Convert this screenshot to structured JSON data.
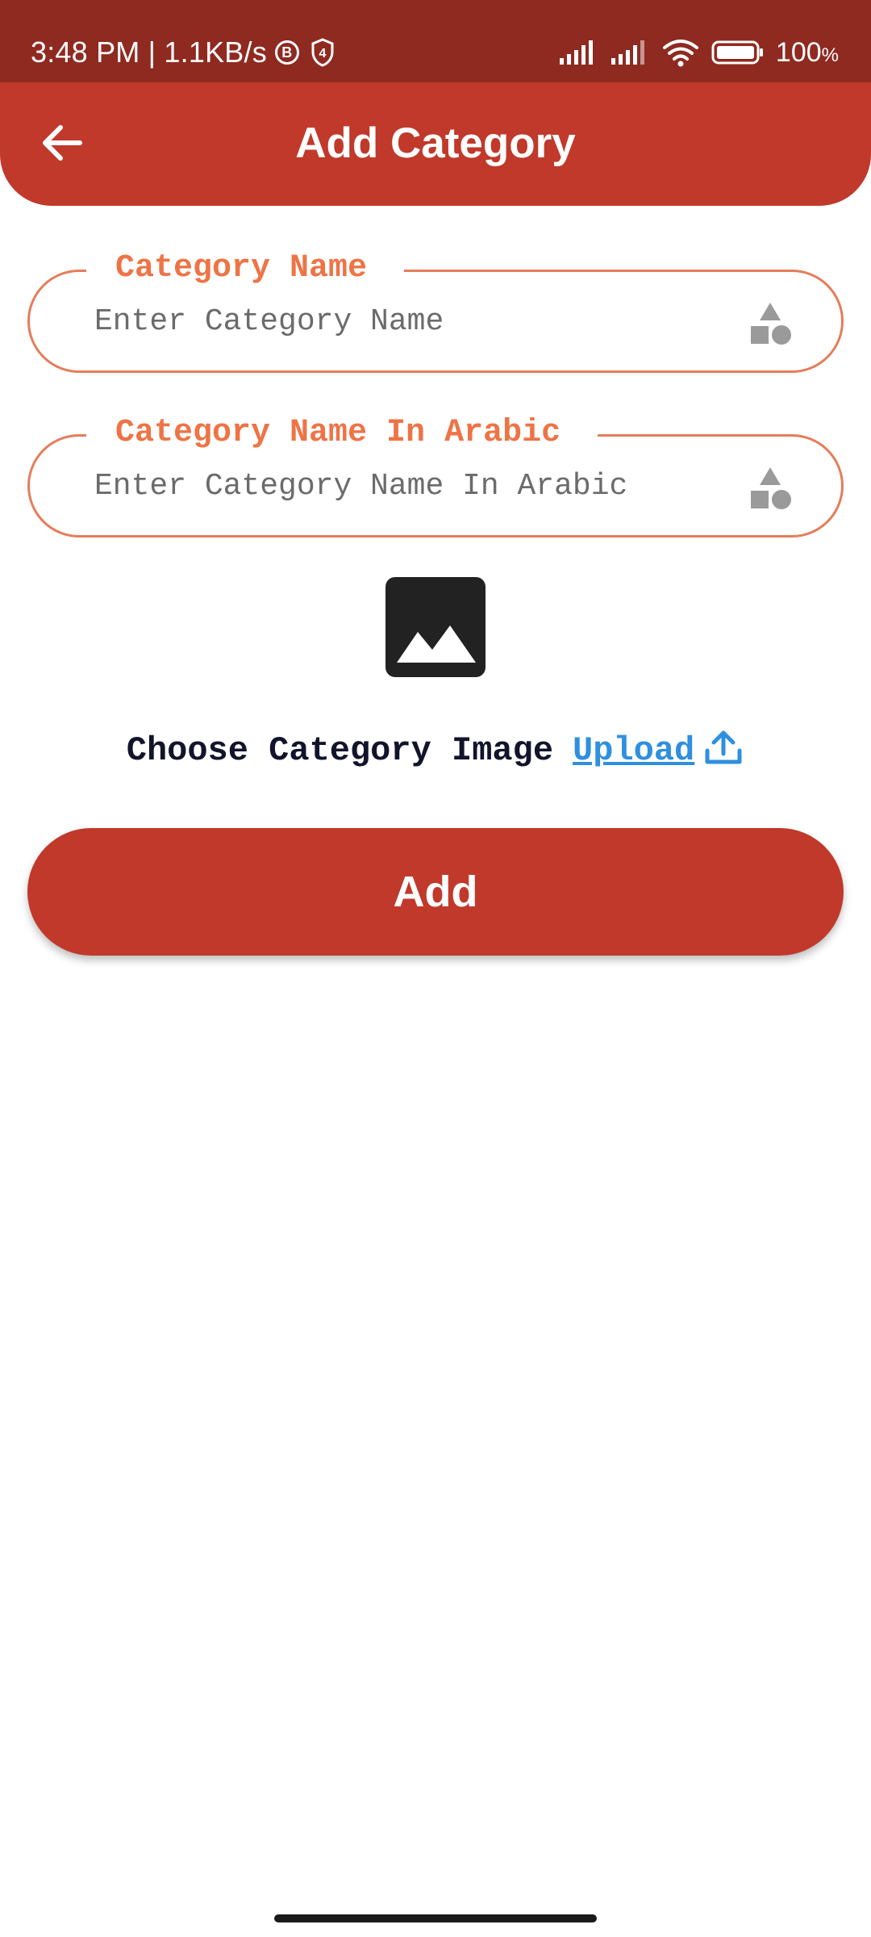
{
  "status_bar": {
    "time_speed": "3:48 PM | 1.1KB/s",
    "badge_b": "B",
    "badge_4": "4",
    "battery": "100",
    "battery_pct_sign": "%"
  },
  "app_bar": {
    "title": "Add Category"
  },
  "form": {
    "category_name": {
      "label": "Category Name",
      "placeholder": "Enter Category Name",
      "value": ""
    },
    "category_name_arabic": {
      "label": "Category Name In Arabic",
      "placeholder": "Enter Category Name In Arabic",
      "value": ""
    }
  },
  "image_picker": {
    "prompt": "Choose Category Image",
    "upload_label": "Upload"
  },
  "actions": {
    "add_label": "Add"
  },
  "colors": {
    "status_bar": "#8f2a21",
    "primary": "#c0392b",
    "field_border": "#e57d5a",
    "label_text": "#ee7446",
    "link": "#2f8fe0"
  },
  "icons": {
    "back": "arrow-left-icon",
    "field": "category-shapes-icon",
    "image": "image-placeholder-icon",
    "upload": "upload-icon"
  }
}
